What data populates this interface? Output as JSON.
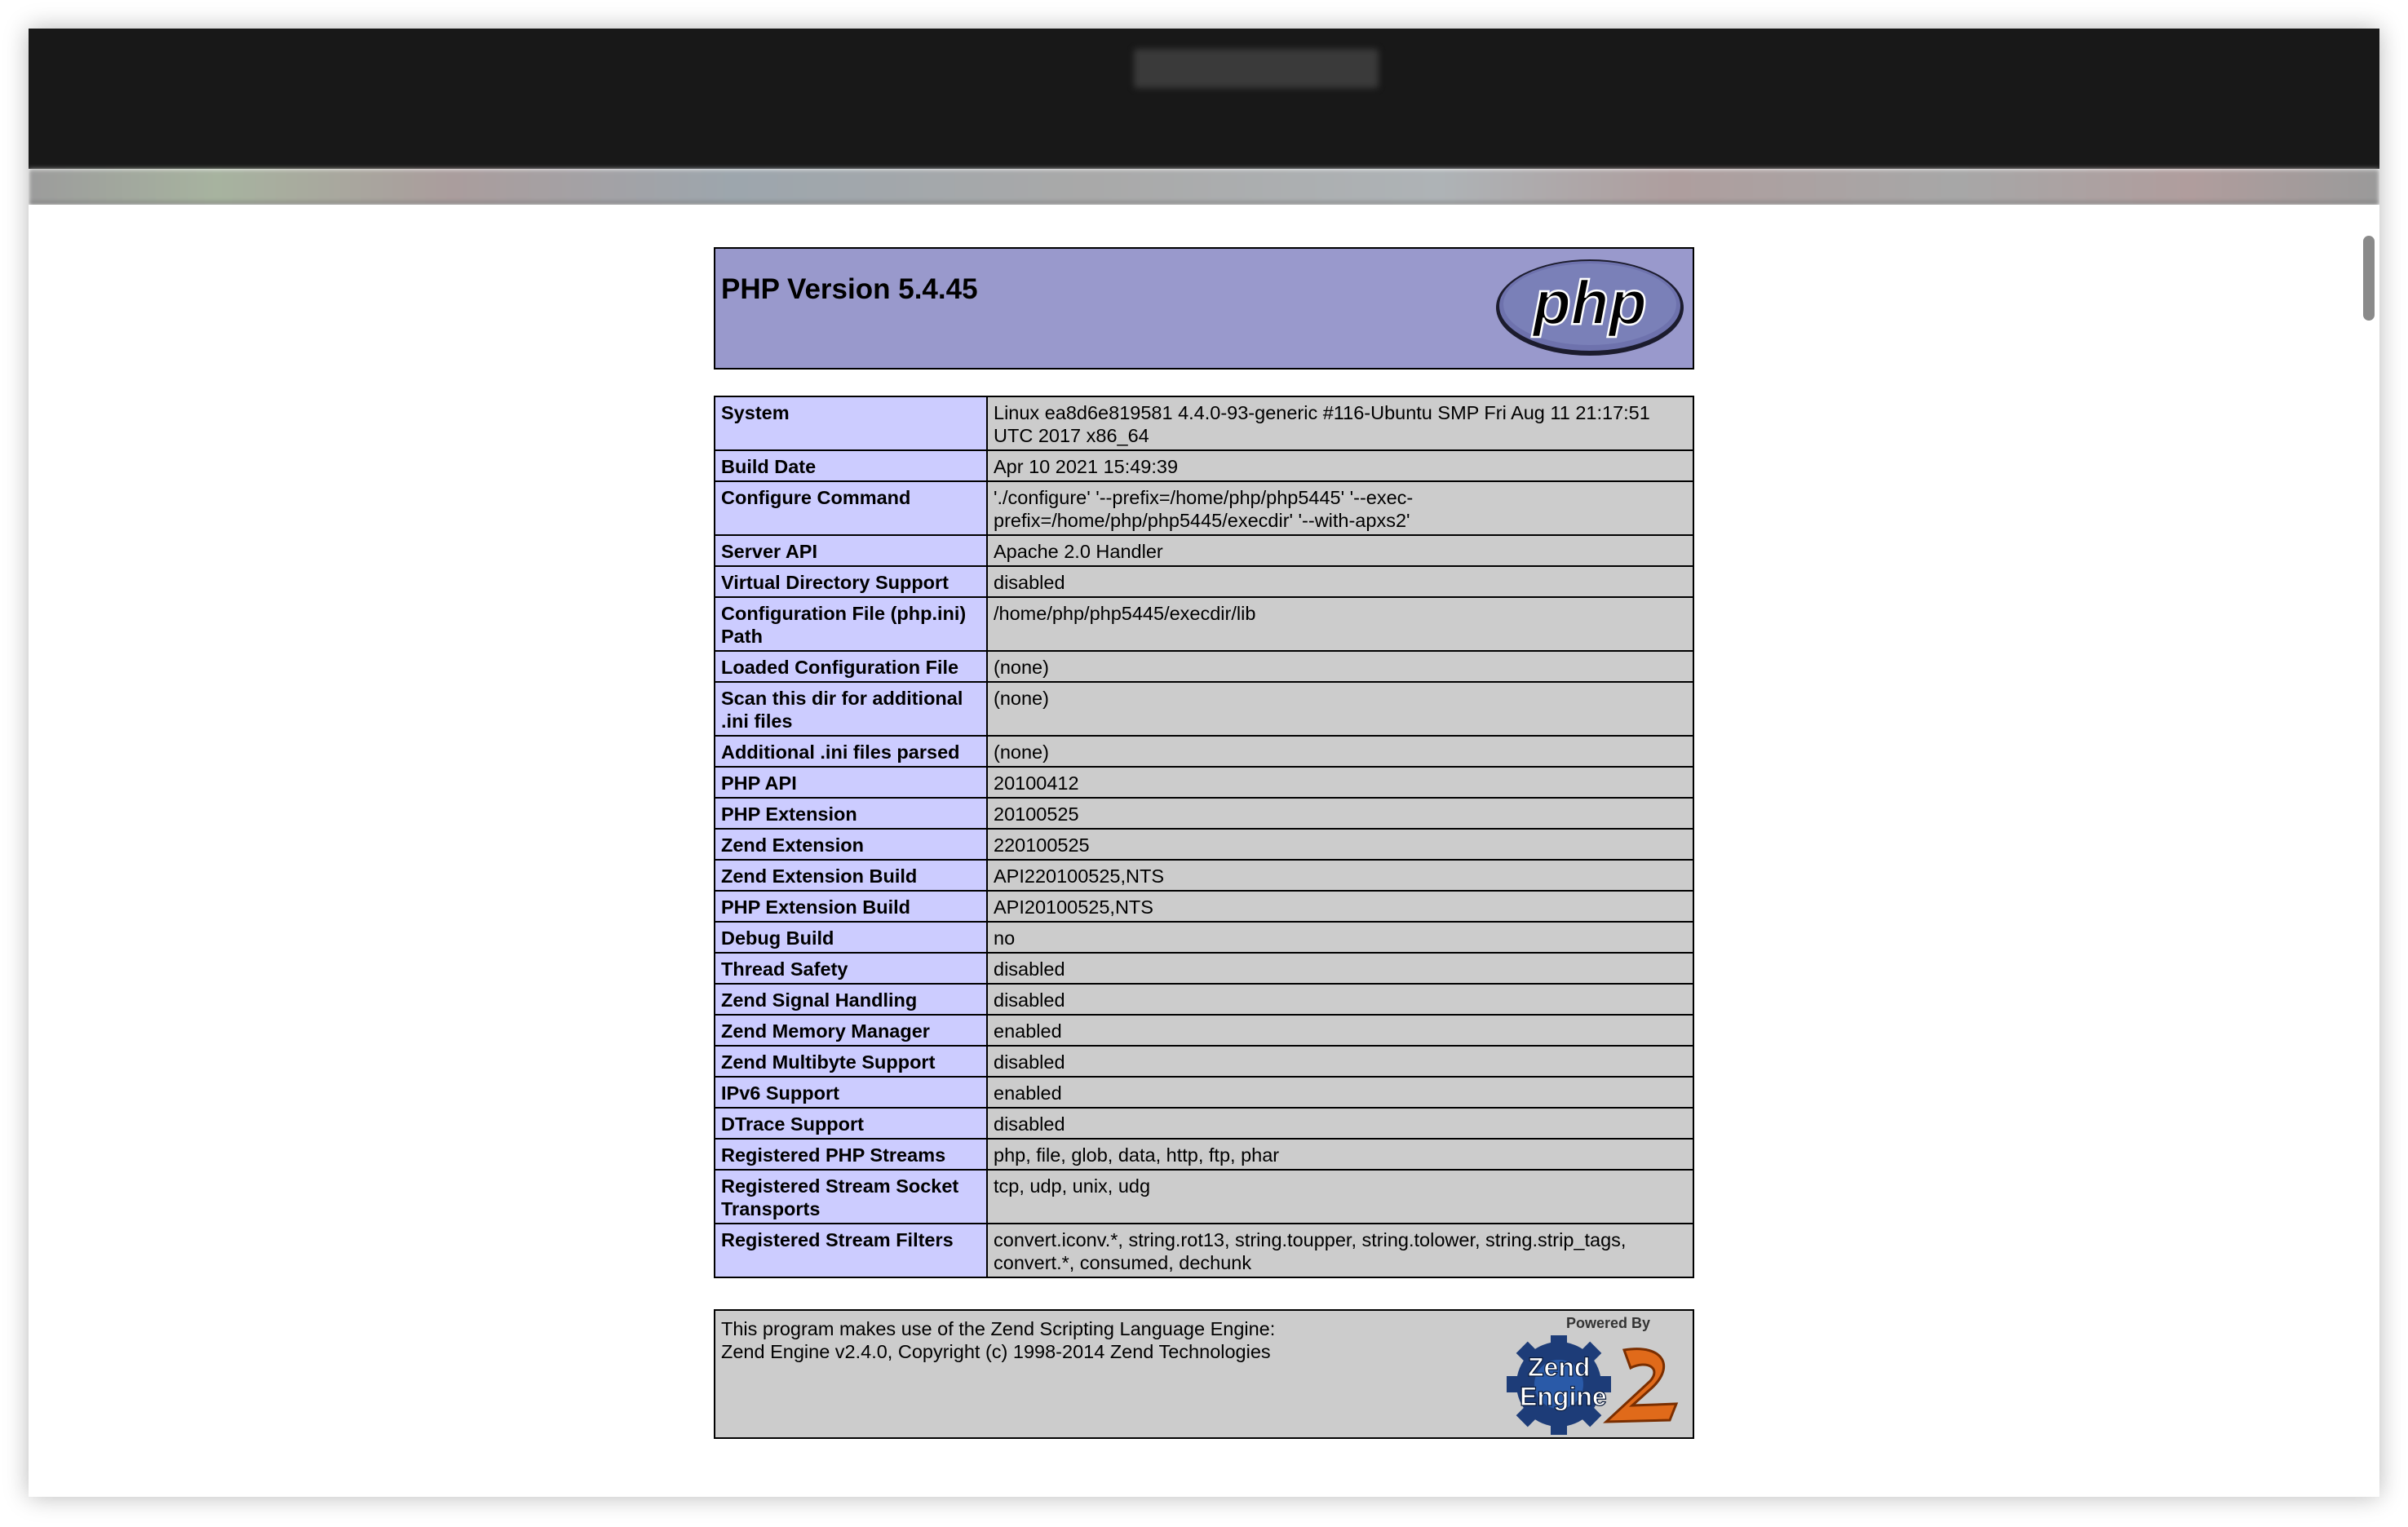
{
  "header": {
    "title": "PHP Version 5.4.45",
    "logo_text": "php"
  },
  "info_rows": [
    {
      "name": "System",
      "value": "Linux ea8d6e819581 4.4.0-93-generic #116-Ubuntu SMP Fri Aug 11 21:17:51 UTC 2017 x86_64"
    },
    {
      "name": "Build Date",
      "value": "Apr 10 2021 15:49:39"
    },
    {
      "name": "Configure Command",
      "value": "'./configure' '--prefix=/home/php/php5445' '--exec-prefix=/home/php/php5445/execdir' '--with-apxs2'"
    },
    {
      "name": "Server API",
      "value": "Apache 2.0 Handler"
    },
    {
      "name": "Virtual Directory Support",
      "value": "disabled"
    },
    {
      "name": "Configuration File (php.ini) Path",
      "value": "/home/php/php5445/execdir/lib"
    },
    {
      "name": "Loaded Configuration File",
      "value": "(none)"
    },
    {
      "name": "Scan this dir for additional .ini files",
      "value": "(none)"
    },
    {
      "name": "Additional .ini files parsed",
      "value": "(none)"
    },
    {
      "name": "PHP API",
      "value": "20100412"
    },
    {
      "name": "PHP Extension",
      "value": "20100525"
    },
    {
      "name": "Zend Extension",
      "value": "220100525"
    },
    {
      "name": "Zend Extension Build",
      "value": "API220100525,NTS"
    },
    {
      "name": "PHP Extension Build",
      "value": "API20100525,NTS"
    },
    {
      "name": "Debug Build",
      "value": "no"
    },
    {
      "name": "Thread Safety",
      "value": "disabled"
    },
    {
      "name": "Zend Signal Handling",
      "value": "disabled"
    },
    {
      "name": "Zend Memory Manager",
      "value": "enabled"
    },
    {
      "name": "Zend Multibyte Support",
      "value": "disabled"
    },
    {
      "name": "IPv6 Support",
      "value": "enabled"
    },
    {
      "name": "DTrace Support",
      "value": "disabled"
    },
    {
      "name": "Registered PHP Streams",
      "value": "php, file, glob, data, http, ftp, phar"
    },
    {
      "name": "Registered Stream Socket Transports",
      "value": "tcp, udp, unix, udg"
    },
    {
      "name": "Registered Stream Filters",
      "value": "convert.iconv.*, string.rot13, string.toupper, string.tolower, string.strip_tags, convert.*, consumed, dechunk"
    }
  ],
  "footer": {
    "line1": "This program makes use of the Zend Scripting Language Engine:",
    "line2": "Zend Engine v2.4.0, Copyright (c) 1998-2014 Zend Technologies",
    "powered_by": "Powered By",
    "logo_text": "Zend Engine 2"
  },
  "colors": {
    "header_bg": "#9999cc",
    "name_cell_bg": "#ccccff",
    "value_cell_bg": "#cccccc"
  }
}
